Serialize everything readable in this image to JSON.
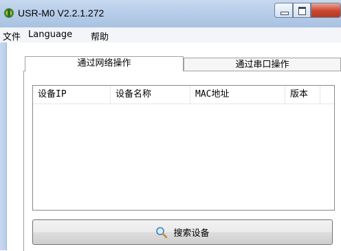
{
  "window": {
    "title": "USR-M0 V2.2.1.272"
  },
  "menu": {
    "items": [
      "文件",
      "Language",
      "帮助"
    ]
  },
  "tabs": [
    {
      "label": "通过网络操作",
      "active": true
    },
    {
      "label": "通过串口操作",
      "active": false
    }
  ],
  "device_list": {
    "columns": [
      "设备IP",
      "设备名称",
      "MAC地址",
      "版本"
    ],
    "rows": []
  },
  "search_button": {
    "label": "搜索设备",
    "icon": "magnifier-icon"
  }
}
